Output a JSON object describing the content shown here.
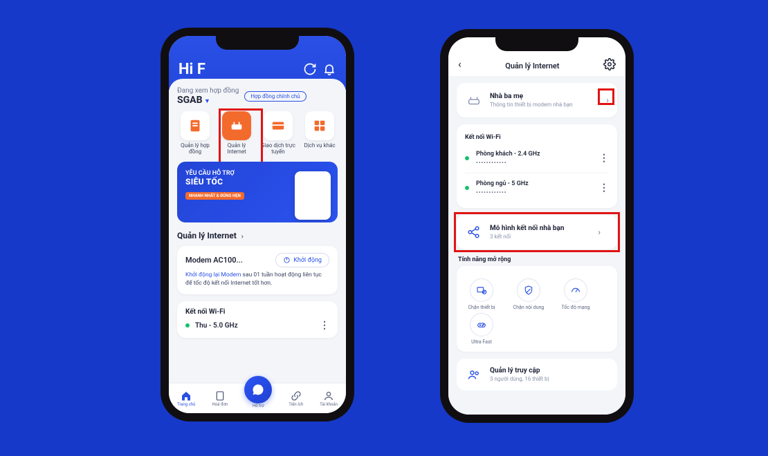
{
  "left": {
    "app_title": "Hi F",
    "contract_label": "Đang xem hợp đồng",
    "contract_code": "SGAB",
    "contract_chip": "Hợp đồng chính chủ",
    "tiles": [
      {
        "label": "Quản lý hợp đồng"
      },
      {
        "label": "Quản lý Internet"
      },
      {
        "label": "Giao dịch trực tuyến"
      },
      {
        "label": "Dịch vụ khác"
      }
    ],
    "promo": {
      "line1": "YÊU CẦU HỖ TRỢ",
      "line2": "SIÊU TỐC",
      "tag": "NHANH NHẤT & ĐÚNG HẸN"
    },
    "section_internet": "Quản lý Internet",
    "modem_name": "Modem AC100...",
    "restart_label": "Khởi động",
    "modem_desc_hl": "Khởi động lại Modem",
    "modem_desc_rest": " sau 01 tuần hoạt động liên tục để tốc độ kết nối Internet tốt hơn.",
    "wifi_title": "Kết nối Wi-Fi",
    "wifi_name": "Thu          - 5.0 GHz",
    "nav": [
      "Trang chủ",
      "Hoá đơn",
      "Hỗ trợ",
      "Tiện ích",
      "Tài khoản"
    ]
  },
  "right": {
    "title": "Quản lý Internet",
    "home": {
      "name": "Nhà ba mẹ",
      "desc": "Thông tin thiết bị modem nhà bạn"
    },
    "wifi_title": "Kết nối Wi-Fi",
    "wifis": [
      {
        "name": "Phòng khách - 2.4 GHz",
        "pwd": "••••••••••••"
      },
      {
        "name": "Phòng ngủ - 5 GHz",
        "pwd": "••••••••••••"
      }
    ],
    "model": {
      "title": "Mô hình kết nối nhà bạn",
      "sub": "3 kết nối"
    },
    "features_title": "Tính năng mở rộng",
    "features": [
      "Chặn thiết bị",
      "Chặn nội dung",
      "Tốc độ mạng",
      "Ultra Fast"
    ],
    "access": {
      "title": "Quản lý truy cập",
      "sub": "3 người dùng, 16 thiết bị"
    }
  }
}
